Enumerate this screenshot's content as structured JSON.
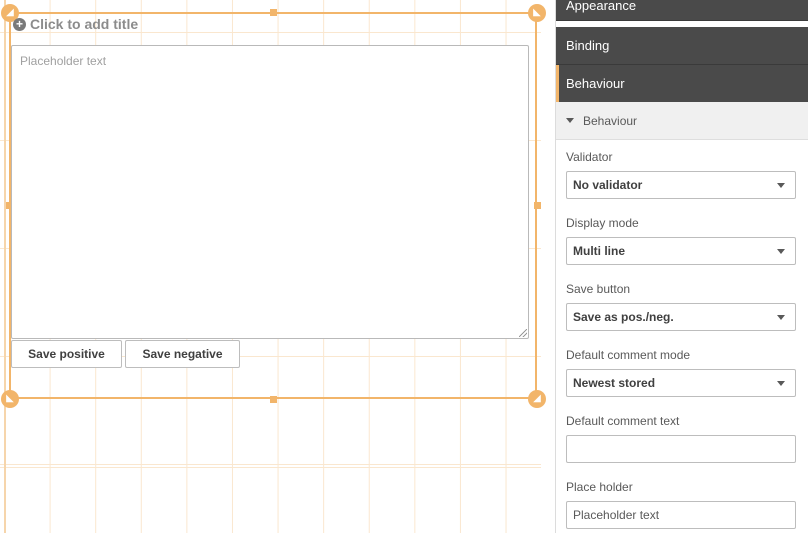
{
  "widget": {
    "title_placeholder": "Click to add title",
    "textarea_placeholder": "Placeholder text",
    "save_positive_label": "Save positive",
    "save_negative_label": "Save negative"
  },
  "panel": {
    "sections": [
      {
        "label": "Appearance"
      },
      {
        "label": "Binding"
      },
      {
        "label": "Behaviour",
        "active": true
      }
    ],
    "subsection": "Behaviour",
    "fields": {
      "validator": {
        "label": "Validator",
        "value": "No validator"
      },
      "display_mode": {
        "label": "Display mode",
        "value": "Multi line"
      },
      "save_button": {
        "label": "Save button",
        "value": "Save as pos./neg."
      },
      "default_comment_mode": {
        "label": "Default comment mode",
        "value": "Newest stored"
      },
      "default_comment_text": {
        "label": "Default comment text",
        "value": ""
      },
      "place_holder": {
        "label": "Place holder",
        "value": "Placeholder text"
      }
    }
  },
  "colors": {
    "accent": "#f2b56a",
    "panel_header": "#4a4a4a",
    "grid": "#fae7cf"
  },
  "icons": {
    "title_add": "plus-circle-icon",
    "subsection_toggle": "caret-down-icon",
    "dropdown": "chevron-down-icon",
    "corner_move": "arrow-corner-icon"
  }
}
